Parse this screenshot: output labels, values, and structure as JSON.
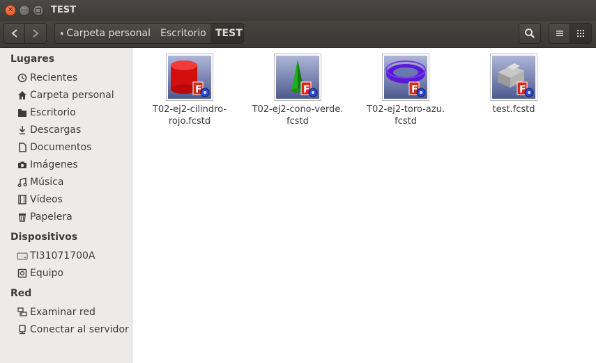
{
  "window": {
    "title": "TEST"
  },
  "toolbar": {
    "breadcrumbs": [
      "Carpeta personal",
      "Escritorio",
      "TEST"
    ]
  },
  "sidebar": {
    "sections": [
      {
        "title": "Lugares",
        "items": [
          {
            "label": "Recientes",
            "icon": "clock-icon"
          },
          {
            "label": "Carpeta personal",
            "icon": "home-icon"
          },
          {
            "label": "Escritorio",
            "icon": "folder-icon"
          },
          {
            "label": "Descargas",
            "icon": "download-icon"
          },
          {
            "label": "Documentos",
            "icon": "document-icon"
          },
          {
            "label": "Imágenes",
            "icon": "camera-icon"
          },
          {
            "label": "Música",
            "icon": "music-icon"
          },
          {
            "label": "Vídeos",
            "icon": "film-icon"
          },
          {
            "label": "Papelera",
            "icon": "trash-icon"
          }
        ]
      },
      {
        "title": "Dispositivos",
        "items": [
          {
            "label": "TI31071700A",
            "icon": "drive-icon"
          },
          {
            "label": "Equipo",
            "icon": "computer-icon"
          }
        ]
      },
      {
        "title": "Red",
        "items": [
          {
            "label": "Examinar red",
            "icon": "network-icon"
          },
          {
            "label": "Conectar al servidor",
            "icon": "server-icon"
          }
        ]
      }
    ]
  },
  "files": [
    {
      "name": "T02-ej2-cilindro-rojo.fcstd",
      "line1": "T02-ej2-cilindro-",
      "line2": "rojo.fcstd",
      "thumbnail": "red-cylinder"
    },
    {
      "name": "T02-ej2-cono-verde.fcstd",
      "line1": "T02-ej2-cono-verde.",
      "line2": "fcstd",
      "thumbnail": "green-cone"
    },
    {
      "name": "T02-ej2-toro-azu.fcstd",
      "line1": "T02-ej2-toro-azu.",
      "line2": "fcstd",
      "thumbnail": "blue-torus"
    },
    {
      "name": "test.fcstd",
      "line1": "test.fcstd",
      "line2": "",
      "thumbnail": "gray-block"
    }
  ],
  "colors": {
    "accent": "#df4a16",
    "toolbar": "#3c3b37"
  }
}
